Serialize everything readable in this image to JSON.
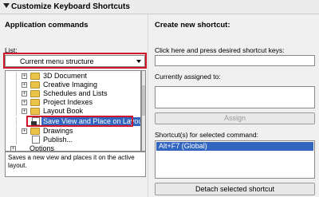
{
  "header": {
    "title": "Customize Keyboard Shortcuts"
  },
  "left": {
    "section_title": "Application commands",
    "list_label": "List:",
    "list_value": "Current menu structure",
    "tree": [
      {
        "label": "3D Document",
        "type": "folder"
      },
      {
        "label": "Creative Imaging",
        "type": "folder"
      },
      {
        "label": "Schedules and Lists",
        "type": "folder"
      },
      {
        "label": "Project Indexes",
        "type": "folder"
      },
      {
        "label": "Layout Book",
        "type": "folder"
      },
      {
        "label": "Save View and Place on Layout",
        "type": "command",
        "selected": true
      },
      {
        "label": "Drawings",
        "type": "folder"
      },
      {
        "label": "Publish...",
        "type": "command"
      },
      {
        "label": "Options",
        "type": "folder"
      }
    ],
    "description": "Saves a new view and places it on the active layout."
  },
  "right": {
    "section_title": "Create new shortcut:",
    "hint": "Click here and press desired shortcut keys:",
    "assigned_label": "Currently assigned to:",
    "assign_button": "Assign",
    "shortcuts_label": "Shortcut(s) for selected command:",
    "shortcuts": [
      "Alt+F7 (Global)"
    ],
    "detach_button": "Detach selected shortcut"
  },
  "colors": {
    "highlight_border": "#d0142a",
    "selection": "#3165c0"
  }
}
